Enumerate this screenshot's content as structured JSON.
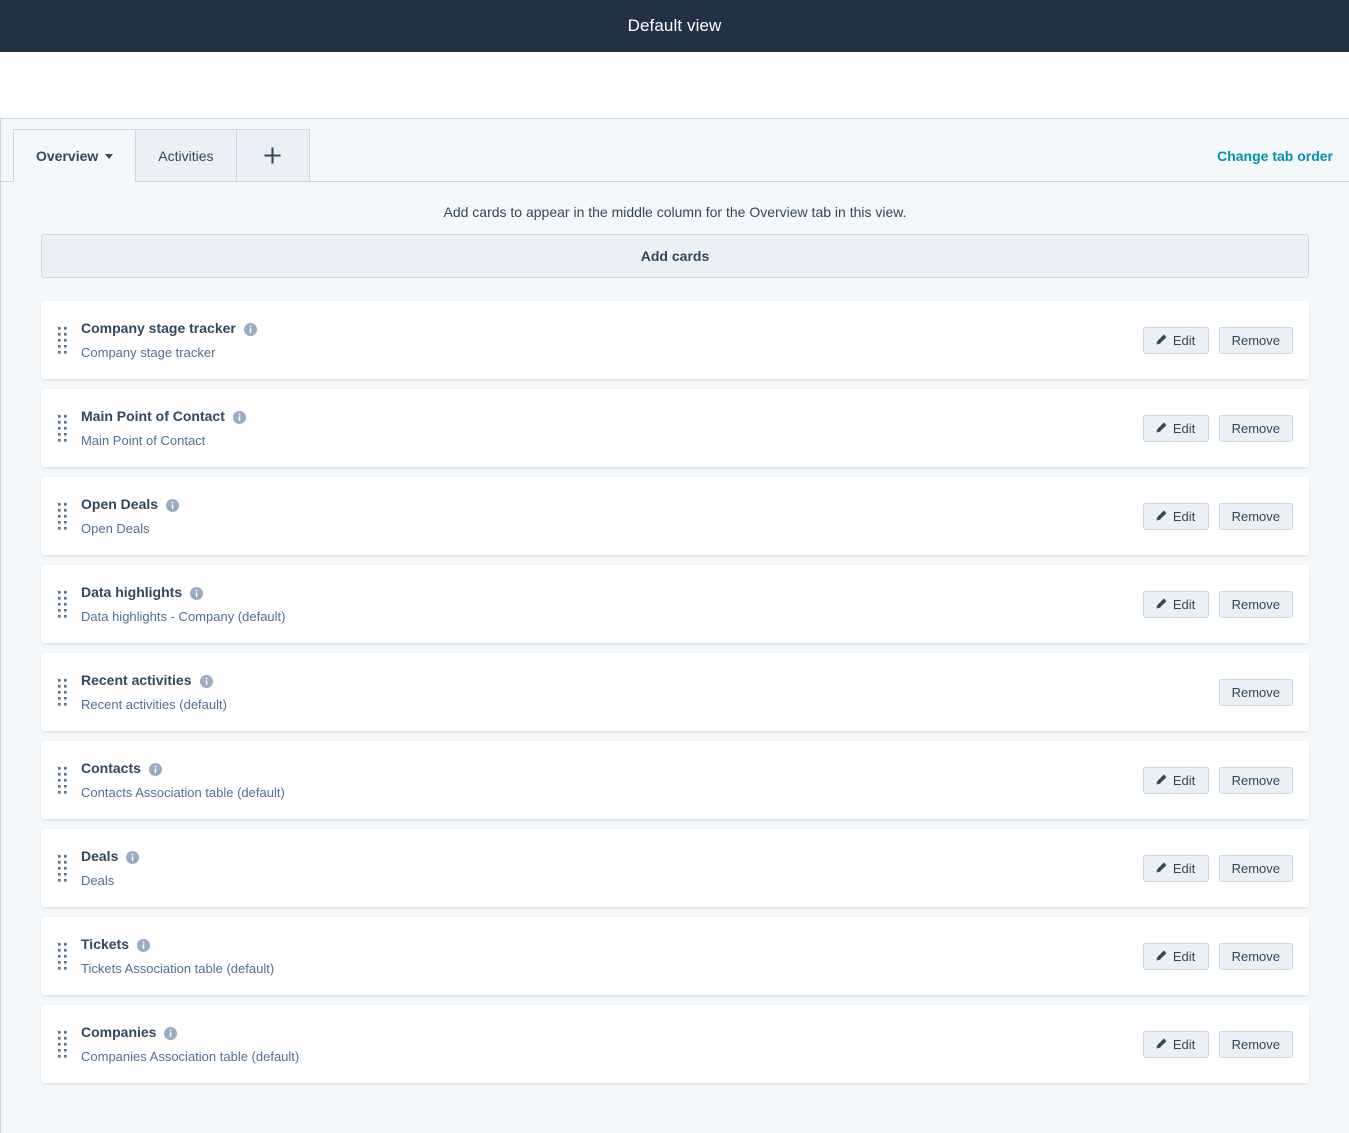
{
  "header": {
    "title": "Default view"
  },
  "tabbar": {
    "tabs": [
      {
        "label": "Overview",
        "active": true,
        "has_caret": true
      },
      {
        "label": "Activities",
        "active": false,
        "has_caret": false
      }
    ],
    "add_tab_icon": "plus-icon",
    "change_tab_order_label": "Change tab order"
  },
  "main": {
    "helper_text": "Add cards to appear in the middle column for the Overview tab in this view.",
    "add_cards_label": "Add cards",
    "edit_label": "Edit",
    "remove_label": "Remove",
    "cards": [
      {
        "title": "Company stage tracker",
        "description": "Company stage tracker",
        "has_edit": true,
        "has_remove": true
      },
      {
        "title": "Main Point of Contact",
        "description": "Main Point of Contact",
        "has_edit": true,
        "has_remove": true
      },
      {
        "title": "Open Deals",
        "description": "Open Deals",
        "has_edit": true,
        "has_remove": true
      },
      {
        "title": "Data highlights",
        "description": "Data highlights - Company (default)",
        "has_edit": true,
        "has_remove": true
      },
      {
        "title": "Recent activities",
        "description": "Recent activities (default)",
        "has_edit": false,
        "has_remove": true
      },
      {
        "title": "Contacts",
        "description": "Contacts Association table (default)",
        "has_edit": true,
        "has_remove": true
      },
      {
        "title": "Deals",
        "description": "Deals",
        "has_edit": true,
        "has_remove": true
      },
      {
        "title": "Tickets",
        "description": "Tickets Association table (default)",
        "has_edit": true,
        "has_remove": true
      },
      {
        "title": "Companies",
        "description": "Companies Association table (default)",
        "has_edit": true,
        "has_remove": true
      }
    ]
  },
  "colors": {
    "header_bg": "#213343",
    "panel_bg": "#f5f8fa",
    "card_bg": "#ffffff",
    "accent_link": "#0091ae",
    "text_primary": "#33475b",
    "text_secondary": "#516f90",
    "border": "#cbd6e2",
    "button_bg": "#eaf0f6",
    "info_icon": "#99acc2"
  }
}
